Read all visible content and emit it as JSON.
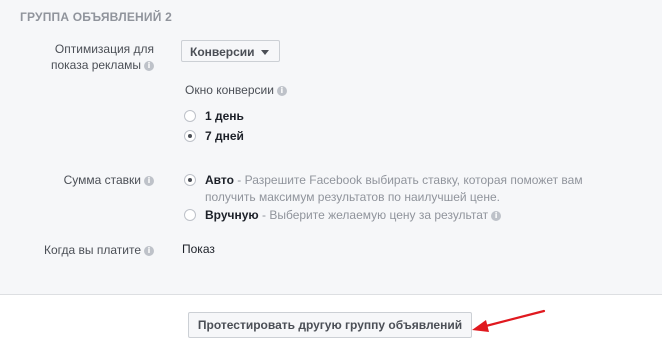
{
  "section": {
    "title": "ГРУППА ОБЪЯВЛЕНИЙ 2"
  },
  "optimization": {
    "label_line1": "Оптимизация для",
    "label_line2": "показа рекламы",
    "selected": "Конверсии"
  },
  "conversion_window": {
    "label": "Окно конверсии",
    "options": [
      {
        "label": "1 день",
        "checked": false
      },
      {
        "label": "7 дней",
        "checked": true
      }
    ]
  },
  "bid": {
    "label": "Сумма ставки",
    "options": [
      {
        "name": "Авто",
        "desc_line1": " - Разрешите Facebook выбирать ставку, которая поможет вам",
        "desc_line2": "получить максимум результатов по наилучшей цене.",
        "checked": true
      },
      {
        "name": "Вручную",
        "desc": " - Выберите желаемую цену за результат",
        "checked": false
      }
    ]
  },
  "payment": {
    "label": "Когда вы платите",
    "value": "Показ"
  },
  "footer": {
    "button_label": "Протестировать другую группу объявлений"
  },
  "icons": {
    "info": "info-icon",
    "arrow": "red-arrow-annotation"
  },
  "colors": {
    "arrow": "#e0191f",
    "accent": "#4b4f56"
  }
}
